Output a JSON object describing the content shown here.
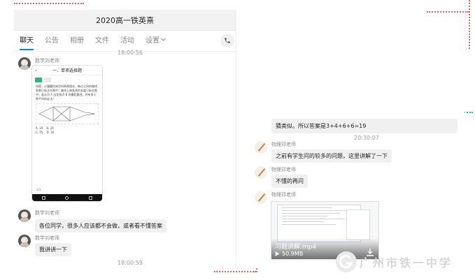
{
  "window": {
    "title": "2020高一铁英熹"
  },
  "tabs": [
    {
      "label": "聊天"
    },
    {
      "label": "公告"
    },
    {
      "label": "相册"
    },
    {
      "label": "文件"
    },
    {
      "label": "活动"
    },
    {
      "label": "设置"
    }
  ],
  "left_chat": {
    "timestamp_top": "18:00:56",
    "timestamp_bottom": "18:00:59",
    "sender": "数学刘老师",
    "phone_screenshot": {
      "header": "一、单项选择题",
      "problem_text": "如图，沙漏圆柱体空间两两相交，每点之间的路线条数已标注在图中；路径上每条线的长度已标在图中，若从点 A 出发到点 B 的最短路径，共有多少种不同的走法？",
      "options": [
        "A. 19",
        "B. 24",
        "C. 25",
        "D. 30"
      ],
      "progress": "1/1"
    },
    "messages": [
      {
        "text": "各位同学，很多人应该都不会做，或者看不懂答案"
      },
      {
        "text": "我讲讲一下"
      }
    ]
  },
  "right_chat": {
    "top_bubble": "猜类似。所以答案是3+4+6+6=19",
    "timestamp": "20:30:07",
    "sender": "物理邓老师",
    "messages": [
      {
        "text": "之前有学生问的较多的问题，这里讲解了一下"
      },
      {
        "text": "不懂的再问"
      }
    ],
    "video": {
      "name": "习题讲解.mp4",
      "size": "50.9MB"
    }
  },
  "watermark": {
    "text": "广州市铁一中学"
  }
}
